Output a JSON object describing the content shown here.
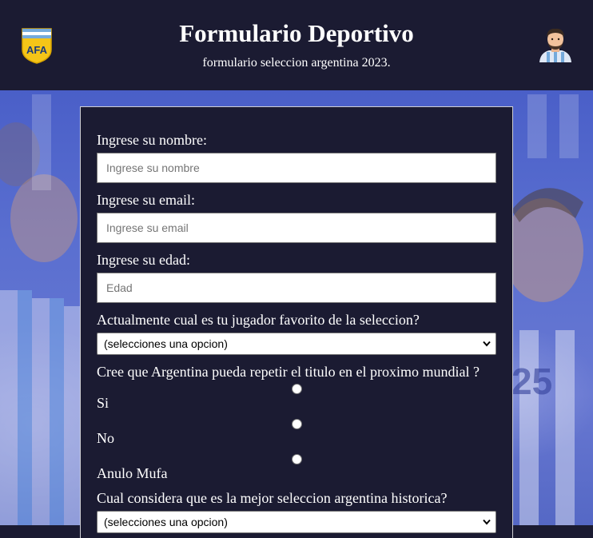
{
  "header": {
    "title": "Formulario Deportivo",
    "subtitle": "formulario seleccion argentina 2023.",
    "logo_icon": "afa-crest-icon",
    "avatar_icon": "player-avatar-icon",
    "logo_text": "AFA"
  },
  "colors": {
    "background": "#1b1b32",
    "text": "#ffffff",
    "input_background": "#ffffff",
    "photo_blue": "#5a6fd0"
  },
  "form": {
    "name": {
      "label": "Ingrese su nombre:",
      "placeholder": "Ingrese su nombre",
      "value": ""
    },
    "email": {
      "label": "Ingrese su email:",
      "placeholder": "Ingrese su email",
      "value": ""
    },
    "age": {
      "label": "Ingrese su edad:",
      "placeholder": "Edad",
      "value": ""
    },
    "favorite_player": {
      "label": "Actualmente cual es tu jugador favorito de la seleccion?",
      "selected": "(selecciones una opcion)"
    },
    "repeat_title": {
      "label": "Cree que Argentina pueda repetir el titulo en el proximo mundial ?",
      "options": [
        {
          "label": "Si",
          "checked": false
        },
        {
          "label": "No",
          "checked": false
        },
        {
          "label": "Anulo Mufa",
          "checked": false
        }
      ]
    },
    "best_team": {
      "label": "Cual considera que es la mejor seleccion argentina historica?",
      "selected": "(selecciones una opcion)"
    }
  }
}
